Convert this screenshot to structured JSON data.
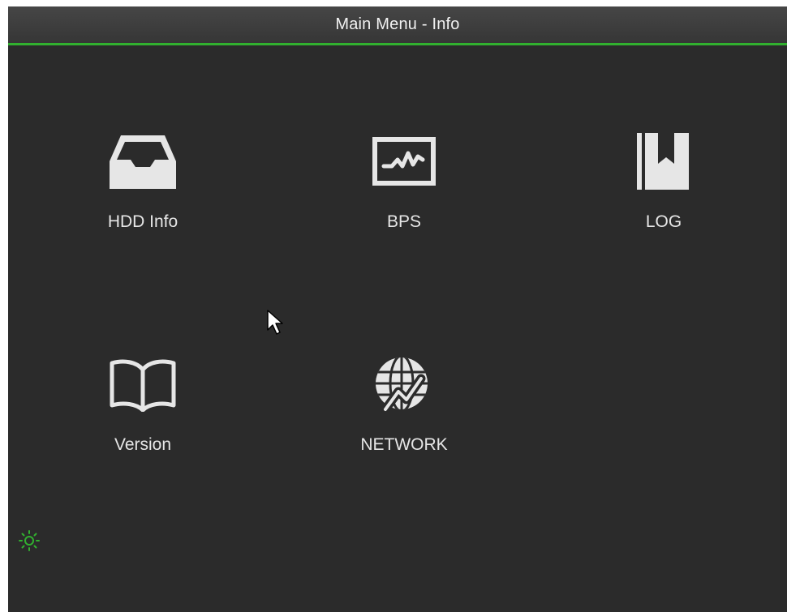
{
  "window": {
    "title": "Main Menu - Info"
  },
  "menu": {
    "items": [
      {
        "label": "HDD Info",
        "icon": "hdd-tray-icon"
      },
      {
        "label": "BPS",
        "icon": "bps-monitor-icon"
      },
      {
        "label": "LOG",
        "icon": "log-book-icon"
      },
      {
        "label": "Version",
        "icon": "open-book-icon"
      },
      {
        "label": "NETWORK",
        "icon": "globe-network-icon"
      }
    ]
  },
  "status": {
    "icon": "sun-icon",
    "color": "#31b02f"
  },
  "theme": {
    "accent": "#31b02f",
    "background": "#2b2b2b",
    "text": "#e6e6e6"
  }
}
